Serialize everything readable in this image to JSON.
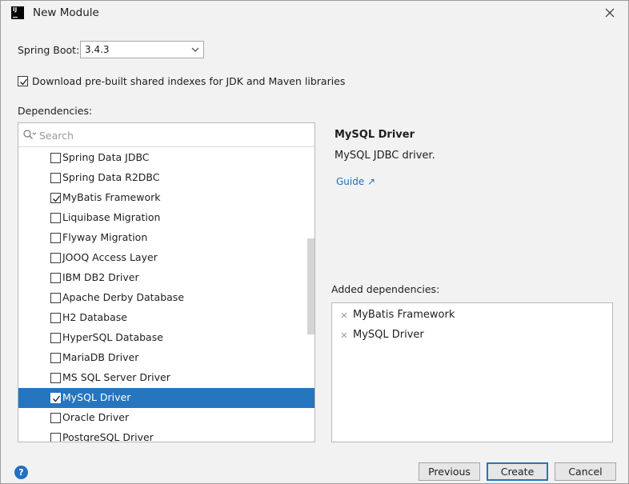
{
  "window": {
    "title": "New Module",
    "app_icon_text": "IJ"
  },
  "spring_boot": {
    "label": "Spring Boot:",
    "version": "3.4.3"
  },
  "indexes_checkbox": {
    "checked": true,
    "label": "Download pre-built shared indexes for JDK and Maven libraries"
  },
  "dependencies": {
    "label": "Dependencies:",
    "search_placeholder": "Search",
    "items": [
      {
        "label": "Spring Data JDBC",
        "checked": false,
        "selected": false
      },
      {
        "label": "Spring Data R2DBC",
        "checked": false,
        "selected": false
      },
      {
        "label": "MyBatis Framework",
        "checked": true,
        "selected": false
      },
      {
        "label": "Liquibase Migration",
        "checked": false,
        "selected": false
      },
      {
        "label": "Flyway Migration",
        "checked": false,
        "selected": false
      },
      {
        "label": "JOOQ Access Layer",
        "checked": false,
        "selected": false
      },
      {
        "label": "IBM DB2 Driver",
        "checked": false,
        "selected": false
      },
      {
        "label": "Apache Derby Database",
        "checked": false,
        "selected": false
      },
      {
        "label": "H2 Database",
        "checked": false,
        "selected": false
      },
      {
        "label": "HyperSQL Database",
        "checked": false,
        "selected": false
      },
      {
        "label": "MariaDB Driver",
        "checked": false,
        "selected": false
      },
      {
        "label": "MS SQL Server Driver",
        "checked": false,
        "selected": false
      },
      {
        "label": "MySQL Driver",
        "checked": true,
        "selected": true
      },
      {
        "label": "Oracle Driver",
        "checked": false,
        "selected": false
      },
      {
        "label": "PostgreSQL Driver",
        "checked": false,
        "selected": false
      }
    ]
  },
  "detail": {
    "title": "MySQL Driver",
    "description": "MySQL JDBC driver.",
    "guide_link": "Guide ↗"
  },
  "added": {
    "label": "Added dependencies:",
    "items": [
      "MyBatis Framework",
      "MySQL Driver"
    ]
  },
  "buttons": {
    "help": "?",
    "previous": "Previous",
    "create": "Create",
    "cancel": "Cancel"
  },
  "colors": {
    "selection": "#2675bf",
    "link": "#2470b3",
    "primary_border": "#2675bf"
  }
}
